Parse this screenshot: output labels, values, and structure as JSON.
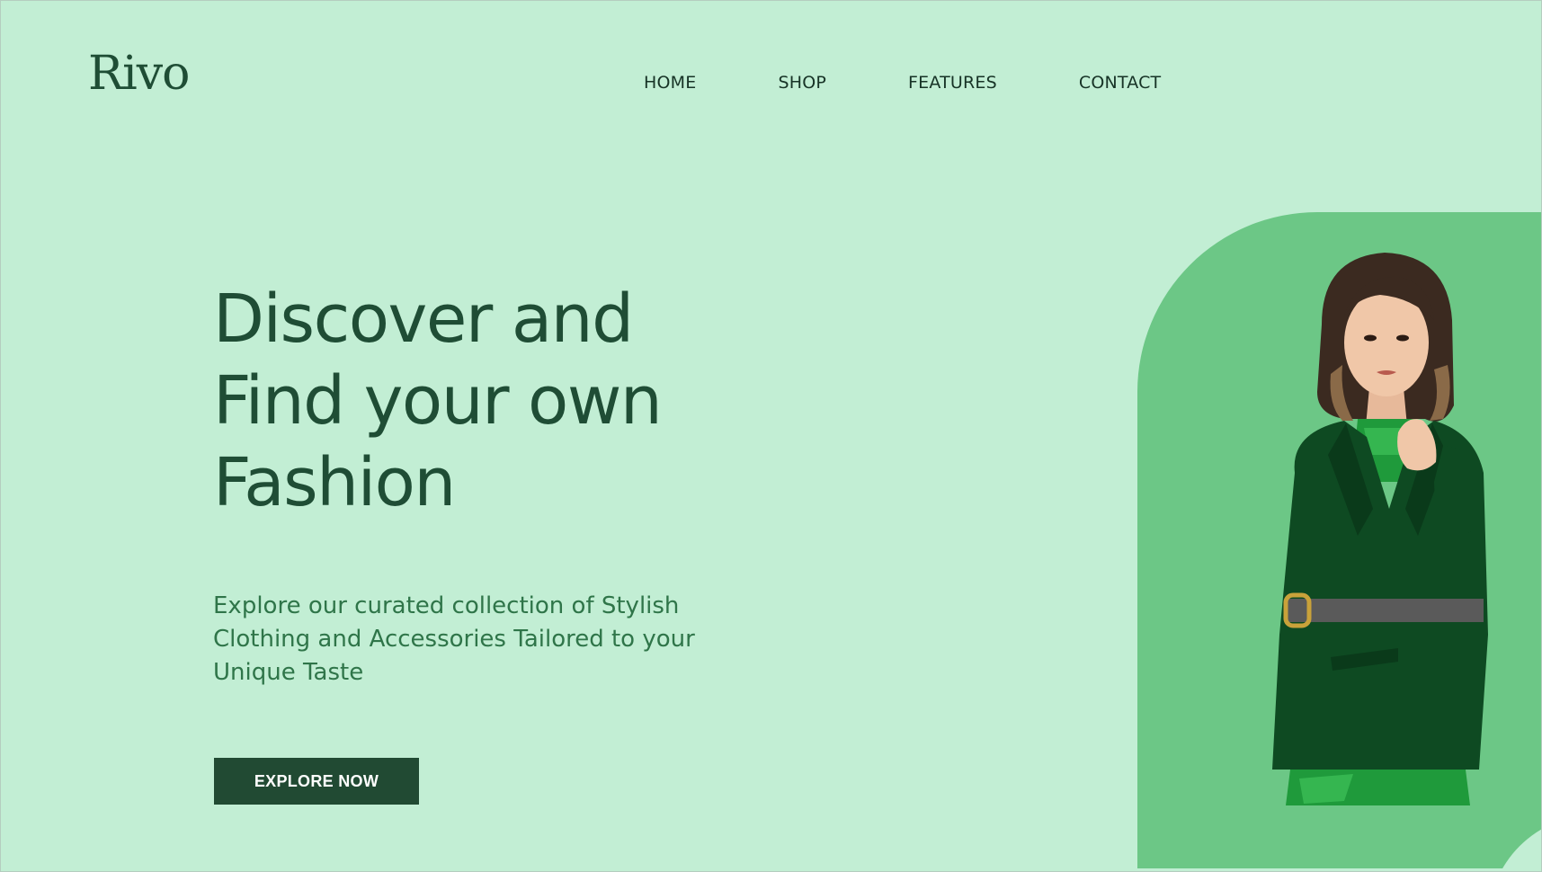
{
  "header": {
    "logo": "Rivo",
    "nav": [
      {
        "label": "HOME"
      },
      {
        "label": "SHOP"
      },
      {
        "label": "FEATURES"
      },
      {
        "label": "CONTACT"
      }
    ]
  },
  "hero": {
    "headline_lines": [
      "Discover and",
      "Find your own",
      "Fashion"
    ],
    "subtitle_lines": [
      "Explore our curated collection of Stylish",
      "Clothing and Accessories Tailored to your",
      "Unique Taste"
    ],
    "cta_label": "EXPLORE NOW",
    "image": "fashion-model-photo"
  },
  "colors": {
    "background": "#c2eed4",
    "panel": "#6cc786",
    "primary": "#214a33",
    "heading": "#1f4d35",
    "subtitle": "#2f7549"
  }
}
